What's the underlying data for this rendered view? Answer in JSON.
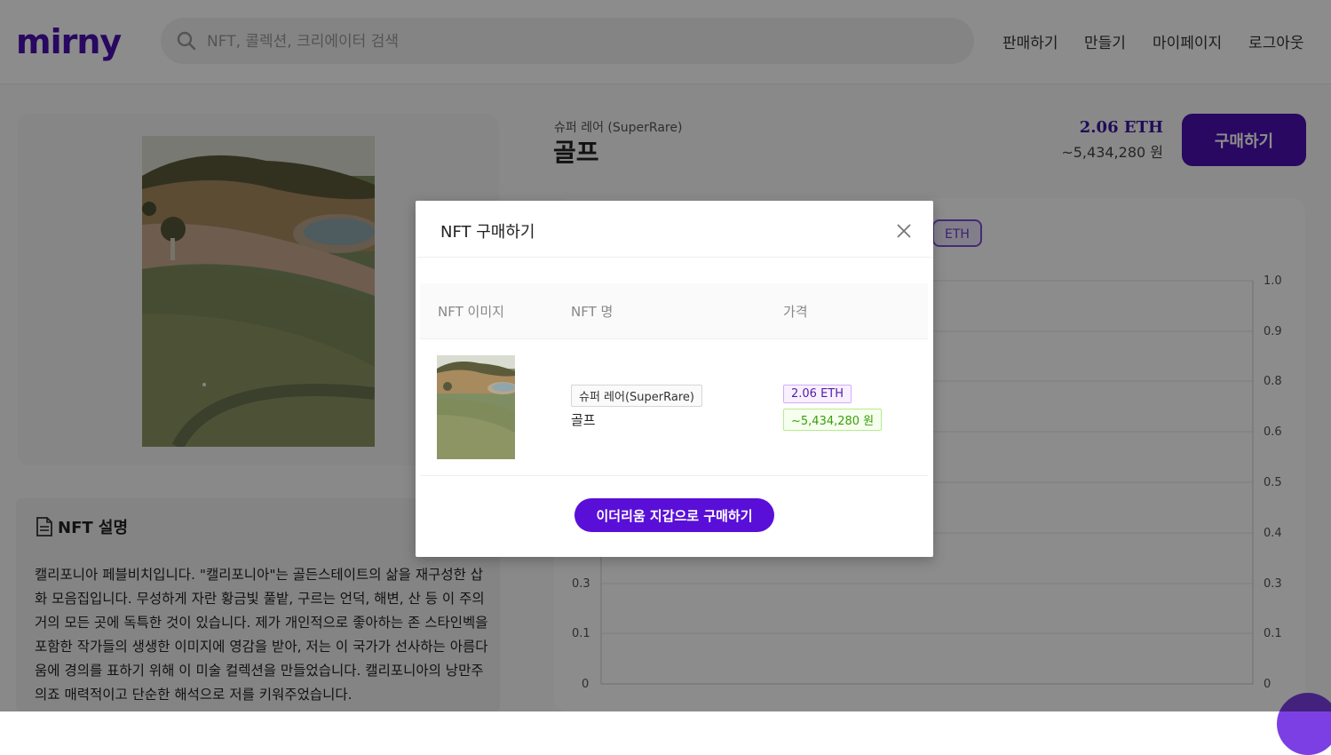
{
  "header": {
    "logo": "mirny",
    "search_placeholder": "NFT, 콜렉션, 크리에이터 검색",
    "nav": [
      "판매하기",
      "만들기",
      "마이페이지",
      "로그아웃"
    ]
  },
  "product": {
    "platform": "슈퍼 레어 (SuperRare)",
    "title": "골프",
    "price_eth": "2.06 ETH",
    "price_krw": "~5,434,280 원",
    "buy_label": "구매하기"
  },
  "description": {
    "title": "NFT 설명",
    "text": "캘리포니아 페블비치입니다. \"캘리포니아\"는 골든스테이트의 삶을 재구성한 삽화 모음집입니다. 무성하게 자란 황금빛 풀밭, 구르는 언덕, 해변, 산 등 이 주의 거의 모든 곳에 독특한 것이 있습니다. 제가 개인적으로 좋아하는 존 스타인벡을 포함한 작가들의 생생한 이미지에 영감을 받아, 저는 이 국가가 선사하는 아름다움에 경의를 표하기 위해 이 미술 컬렉션을 만들었습니다. 캘리포니아의 낭만주의죠 매력적이고 단순한 해석으로 저를 키워주었습니다."
  },
  "chart": {
    "tab": "ETH",
    "y_ticks": [
      "1.0",
      "0.9",
      "0.8",
      "0.6",
      "0.5",
      "0.4",
      "0.3",
      "0.1",
      "0"
    ],
    "y_ticks_left": [
      "0.3",
      "0.1",
      "0"
    ]
  },
  "modal": {
    "title": "NFT 구매하기",
    "columns": [
      "NFT 이미지",
      "NFT 명",
      "가격"
    ],
    "row": {
      "platform": "슈퍼 레어(SuperRare)",
      "name": "골프",
      "price_eth": "2.06 ETH",
      "price_krw": "~5,434,280 원"
    },
    "buy_button": "이더리움 지갑으로 구매하기"
  },
  "colors": {
    "brand": "#4a10b0",
    "modal_button": "#5a0fd8"
  }
}
